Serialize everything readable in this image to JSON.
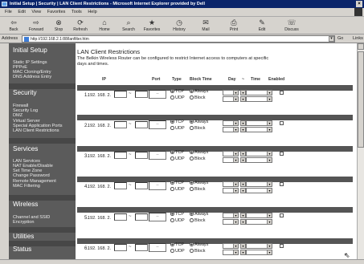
{
  "window": {
    "title": "Initial Setup | Security | LAN Client Restrictions - Microsoft Internet Explorer provided by Dell"
  },
  "menu": [
    "File",
    "Edit",
    "View",
    "Favorites",
    "Tools",
    "Help"
  ],
  "toolbar": [
    {
      "label": "Back",
      "icon": "back-arrow-icon",
      "glyph": "⇦"
    },
    {
      "label": "Forward",
      "icon": "forward-arrow-icon",
      "glyph": "⇨"
    },
    {
      "label": "Stop",
      "icon": "stop-icon",
      "glyph": "⊗"
    },
    {
      "label": "Refresh",
      "icon": "refresh-icon",
      "glyph": "⟳"
    },
    {
      "label": "Home",
      "icon": "home-icon",
      "glyph": "⌂"
    },
    {
      "label": "Search",
      "icon": "search-icon",
      "glyph": "⌕"
    },
    {
      "label": "Favorites",
      "icon": "favorites-icon",
      "glyph": "★"
    },
    {
      "label": "History",
      "icon": "history-icon",
      "glyph": "◷"
    },
    {
      "label": "Mail",
      "icon": "mail-icon",
      "glyph": "✉"
    },
    {
      "label": "Print",
      "icon": "print-icon",
      "glyph": "⎙"
    },
    {
      "label": "Edit",
      "icon": "edit-icon",
      "glyph": "✎"
    },
    {
      "label": "Discuss",
      "icon": "discuss-icon",
      "glyph": "☏"
    }
  ],
  "address": {
    "label": "Address",
    "url": "http://192.168.2.1:88/lanfilter.htm",
    "go": "Go",
    "links": "Links"
  },
  "sidebar": {
    "sections": [
      {
        "title": "Initial Setup",
        "items": [
          "Static IP Settings",
          "PPPoE",
          "MAC Cloning/Entry",
          "DNS Address Entry"
        ]
      },
      {
        "title": "Security",
        "items": [
          "Firewall",
          "Security Log",
          "DMZ",
          "Virtual Server",
          "Special Application Ports",
          "LAN Client Restrictions"
        ]
      },
      {
        "title": "Services",
        "items": [
          "LAN Services",
          "NAT Enable/Disable",
          "Set Time Zone",
          "Change Password",
          "Remote Management",
          "MAC Filtering"
        ]
      },
      {
        "title": "Wireless",
        "items": [
          "Channel and SSID",
          "Encryption"
        ]
      },
      {
        "title": "Utilities",
        "items": []
      },
      {
        "title": "Status",
        "items": []
      }
    ]
  },
  "page": {
    "title": "LAN Client Restrictions",
    "description": "The Belkin Wireless Router can be configured to restrict Internet access to computers at specific days and times."
  },
  "table": {
    "headers": {
      "ip": "IP",
      "port": "Port",
      "type": "Type",
      "block_time": "Block Time",
      "day": "Day",
      "tilde": "~",
      "time": "Time",
      "enabled": "Enabled"
    },
    "ip_prefix": "192. 168. 2.",
    "tilde": "~",
    "port_sep": "--",
    "type_options": [
      "TCP",
      "UDP"
    ],
    "block_options": [
      "Always",
      "Block"
    ],
    "rows": [
      {
        "num": "1.",
        "type": "TCP",
        "block": "Always",
        "enabled": false
      },
      {
        "num": "2.",
        "type": "TCP",
        "block": "Always",
        "enabled": false
      },
      {
        "num": "3.",
        "type": "TCP",
        "block": "Always",
        "enabled": false
      },
      {
        "num": "4.",
        "type": "TCP",
        "block": "Always",
        "enabled": false
      },
      {
        "num": "5.",
        "type": "TCP",
        "block": "Always",
        "enabled": false
      },
      {
        "num": "6.",
        "type": "TCP",
        "block": "Always",
        "enabled": false
      }
    ]
  }
}
